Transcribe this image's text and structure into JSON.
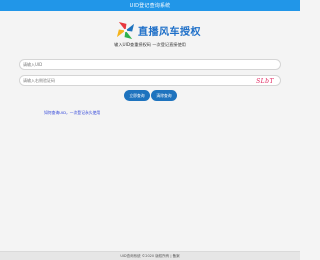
{
  "header": {
    "title": "UID登记查询系统"
  },
  "brand": {
    "name": "直播风车授权",
    "subtitle": "输入UID查重授权码 一次登记直接使用"
  },
  "form": {
    "uid_placeholder": "请输入UID",
    "captcha_placeholder": "请输入右侧验证码",
    "captcha_text": "SLbT"
  },
  "buttons": {
    "query_label": "立即查询",
    "clear_label": "清除查询"
  },
  "help": {
    "link_text": "如何查询UID，一次登记永久使用"
  },
  "footer": {
    "text": "UID查询系统 ©2020 版权所有 | 备案"
  },
  "colors": {
    "primary": "#2196e8",
    "button": "#1e73be",
    "captcha": "#e0245e",
    "link": "#2a3fd8"
  }
}
